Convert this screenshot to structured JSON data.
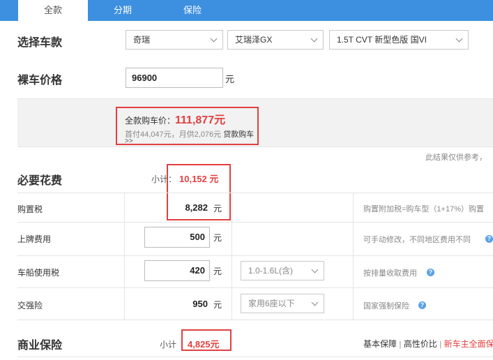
{
  "tabs": [
    "全款",
    "分期",
    "保险"
  ],
  "select_model": {
    "title": "选择车款",
    "brand": "奇瑞",
    "series": "艾瑞泽GX",
    "version": "1.5T CVT 新型色版 国VI"
  },
  "bare_price": {
    "title": "裸车价格",
    "value": "96900",
    "unit": "元"
  },
  "summary": {
    "full_label": "全款购车价：",
    "full_value": "111,877元",
    "loan_text": "首付44,047元，月供2,076元",
    "loan_link": "贷款购车",
    "loan_arrows": ">>"
  },
  "note": "此结果仅供参考，",
  "required": {
    "title": "必要花费",
    "subtotal_label": "小计：",
    "subtotal_value": "10,152 元",
    "rows": [
      {
        "label": "购置税",
        "value": "8,282",
        "unit": "元",
        "hint": "购置附加税=购车型（1+17%）购置"
      },
      {
        "label": "上牌费用",
        "value": "500",
        "unit": "元",
        "hint": "可手动修改，不同地区费用不同"
      },
      {
        "label": "车船使用税",
        "value": "420",
        "unit": "元",
        "select": "1.0-1.6L(含)",
        "hint": "按排量收取费用"
      },
      {
        "label": "交强险",
        "value": "950",
        "unit": "元",
        "select": "家用6座以下",
        "hint": "国家强制保险"
      }
    ]
  },
  "commercial": {
    "title": "商业保险",
    "subtotal_label": "小计",
    "subtotal_value": "4,825元",
    "opt1": "基本保障",
    "sep1": "|",
    "opt2": "高性价比",
    "sep2": "|",
    "opt3": "新车主全面保"
  },
  "colors": {
    "accent": "#3d8fe0",
    "highlight": "#e0403f"
  }
}
